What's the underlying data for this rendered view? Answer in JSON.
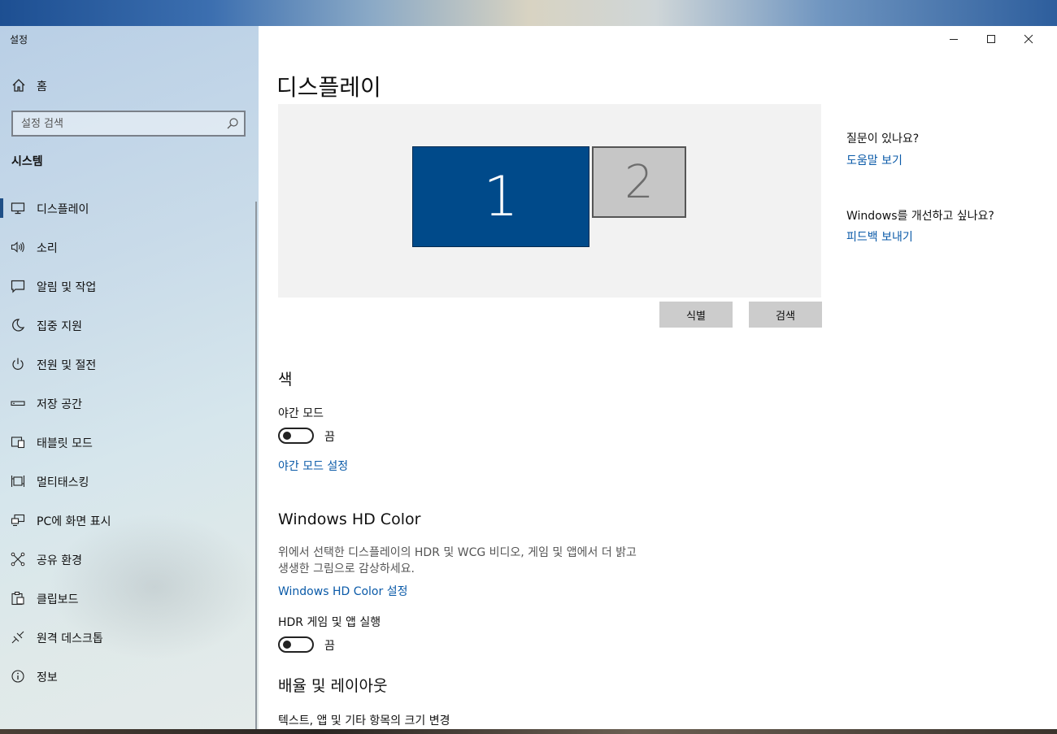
{
  "app": {
    "title": "설정"
  },
  "sidebar": {
    "home_label": "홈",
    "search_placeholder": "설정 검색",
    "section_title": "시스템",
    "items": [
      {
        "label": "디스플레이",
        "icon": "monitor-icon",
        "selected": true
      },
      {
        "label": "소리",
        "icon": "speaker-icon"
      },
      {
        "label": "알림 및 작업",
        "icon": "notification-icon"
      },
      {
        "label": "집중 지원",
        "icon": "moon-icon"
      },
      {
        "label": "전원 및 절전",
        "icon": "power-icon"
      },
      {
        "label": "저장 공간",
        "icon": "storage-icon"
      },
      {
        "label": "태블릿 모드",
        "icon": "tablet-icon"
      },
      {
        "label": "멀티태스킹",
        "icon": "multitasking-icon"
      },
      {
        "label": "PC에 화면 표시",
        "icon": "project-icon"
      },
      {
        "label": "공유 환경",
        "icon": "share-icon"
      },
      {
        "label": "클립보드",
        "icon": "clipboard-icon"
      },
      {
        "label": "원격 데스크톱",
        "icon": "remote-desktop-icon"
      },
      {
        "label": "정보",
        "icon": "info-icon"
      }
    ]
  },
  "main": {
    "title": "디스플레이",
    "monitors": [
      {
        "label": "1",
        "active": true
      },
      {
        "label": "2",
        "active": false
      }
    ],
    "identify_label": "식별",
    "detect_label": "검색",
    "color_section": {
      "heading": "색",
      "night_mode_label": "야간 모드",
      "night_mode_state": "끔",
      "night_mode_link": "야간 모드 설정"
    },
    "hdr_section": {
      "heading": "Windows HD Color",
      "description": "위에서 선택한 디스플레이의 HDR 및 WCG 비디오, 게임 및 앱에서 더 밝고 생생한 그림으로 감상하세요.",
      "settings_link": "Windows HD Color 설정",
      "hdr_games_label": "HDR 게임 및 앱 실행",
      "hdr_games_state": "끔"
    },
    "scale_section": {
      "heading": "배율 및 레이아웃",
      "text_size_label": "텍스트, 앱 및 기타 항목의 크기 변경"
    }
  },
  "help_panel": {
    "question": "질문이 있나요?",
    "help_link": "도움말 보기",
    "improve_question": "Windows를 개선하고 싶나요?",
    "feedback_link": "피드백 보내기"
  },
  "colors": {
    "accent": "#004a8a",
    "link": "#0a5aa8",
    "monitor_inactive": "#c6c6c6"
  }
}
